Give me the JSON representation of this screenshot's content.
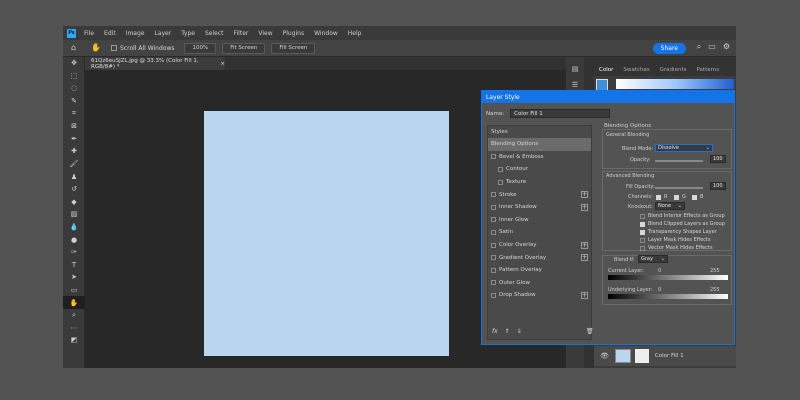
{
  "menu": {
    "logo": "Ps",
    "items": [
      "File",
      "Edit",
      "Image",
      "Layer",
      "Type",
      "Select",
      "Filter",
      "View",
      "Plugins",
      "Window",
      "Help"
    ]
  },
  "options_bar": {
    "scroll_all_windows": "Scroll All Windows",
    "zoom_value": "100%",
    "fit_screen": "Fit Screen",
    "fill_screen": "Fill Screen",
    "share": "Share"
  },
  "document": {
    "tab_title": "61Qz6euSJZL.jpg @ 33.3% (Color Fill 1, RGB/8#) *",
    "canvas_color": "#b8d6f0"
  },
  "right_panel": {
    "tabs": [
      "Color",
      "Swatches",
      "Gradients",
      "Patterns"
    ],
    "active_tab": "Color"
  },
  "layers": {
    "row": {
      "name": "Color Fill 1"
    }
  },
  "dialog": {
    "title": "Layer Style",
    "name_label": "Name:",
    "name_value": "Color Fill 1",
    "styles_header": "Styles",
    "styles": [
      {
        "label": "Blending Options",
        "selected": true
      },
      {
        "label": "Bevel & Emboss",
        "checkbox": true
      },
      {
        "label": "Contour",
        "checkbox": true,
        "sub": true
      },
      {
        "label": "Texture",
        "checkbox": true,
        "sub": true
      },
      {
        "label": "Stroke",
        "checkbox": true,
        "plus": true
      },
      {
        "label": "Inner Shadow",
        "checkbox": true,
        "plus": true
      },
      {
        "label": "Inner Glow",
        "checkbox": true
      },
      {
        "label": "Satin",
        "checkbox": true
      },
      {
        "label": "Color Overlay",
        "checkbox": true,
        "plus": true
      },
      {
        "label": "Gradient Overlay",
        "checkbox": true,
        "plus": true
      },
      {
        "label": "Pattern Overlay",
        "checkbox": true
      },
      {
        "label": "Outer Glow",
        "checkbox": true
      },
      {
        "label": "Drop Shadow",
        "checkbox": true,
        "plus": true
      }
    ],
    "blending": {
      "section_title": "Blending Options",
      "general_title": "General Blending",
      "blend_mode_label": "Blend Mode:",
      "blend_mode_value": "Dissolve",
      "opacity_label": "Opacity:",
      "opacity_value": "100",
      "advanced_title": "Advanced Blending",
      "fill_opacity_label": "Fill Opacity:",
      "fill_opacity_value": "100",
      "channels_label": "Channels:",
      "channels": [
        "R",
        "G",
        "B"
      ],
      "knockout_label": "Knockout:",
      "knockout_value": "None",
      "options": [
        "Blend Interior Effects as Group",
        "Blend Clipped Layers as Group",
        "Transparency Shapes Layer",
        "Layer Mask Hides Effects",
        "Vector Mask Hides Effects"
      ],
      "options_checked": [
        false,
        true,
        true,
        false,
        false
      ],
      "blend_if_label": "Blend If:",
      "blend_if_value": "Gray",
      "current_layer_label": "Current Layer:",
      "underlying_layer_label": "Underlying Layer:",
      "range_min": "0",
      "range_max": "255"
    }
  }
}
